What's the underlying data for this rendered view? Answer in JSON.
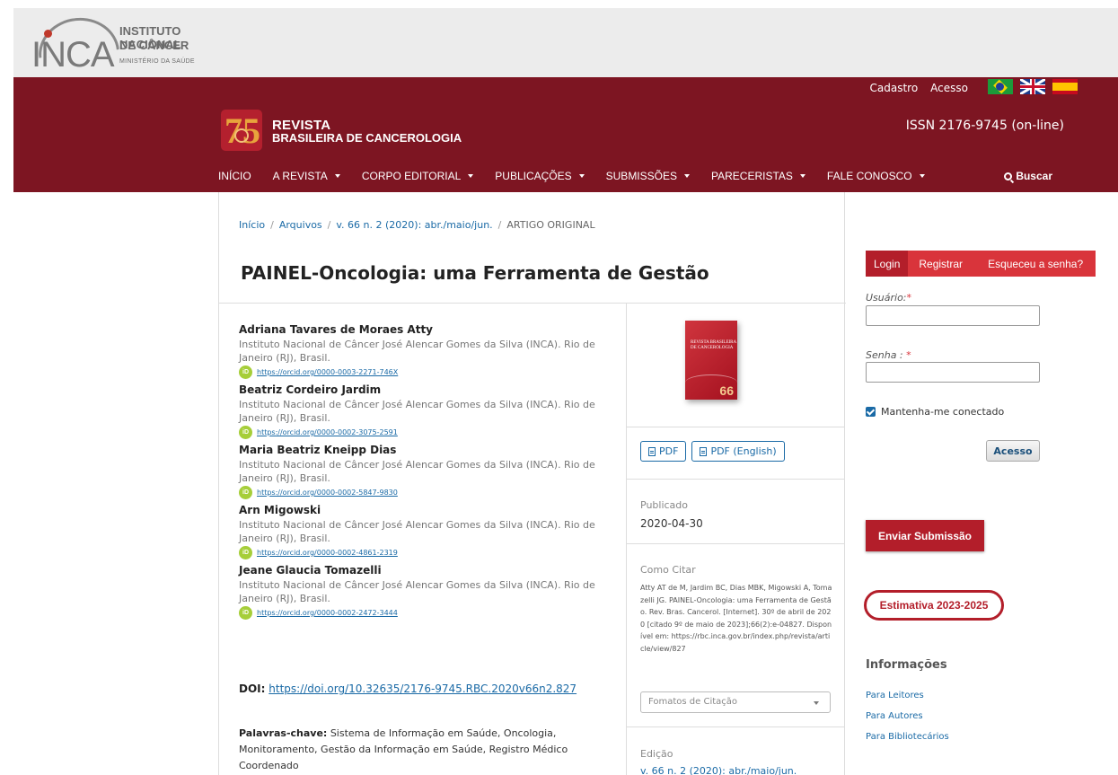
{
  "gov": {
    "logo_word": "INCA",
    "line1": "INSTITUTO NACIONAL",
    "line2": "DE CÂNCER",
    "line3": "MINISTÉRIO DA SAÚDE"
  },
  "header": {
    "cadastro": "Cadastro",
    "acesso": "Acesso",
    "flags": [
      "flag-brazil",
      "flag-uk",
      "flag-spain"
    ],
    "logo_number": "75",
    "journal_title_1": "REVISTA",
    "journal_title_2": "BRASILEIRA DE CANCEROLOGIA",
    "issn": "ISSN 2176-9745 (on-line)"
  },
  "nav": {
    "items": [
      {
        "label": "INÍCIO",
        "dropdown": false
      },
      {
        "label": "A REVISTA",
        "dropdown": true
      },
      {
        "label": "CORPO EDITORIAL",
        "dropdown": true
      },
      {
        "label": "PUBLICAÇÕES",
        "dropdown": true
      },
      {
        "label": "SUBMISSÕES",
        "dropdown": true
      },
      {
        "label": "PARECERISTAS",
        "dropdown": true
      },
      {
        "label": "FALE CONOSCO",
        "dropdown": true
      }
    ],
    "search_label": "Buscar"
  },
  "breadcrumb": {
    "home": "Início",
    "archives": "Arquivos",
    "issue": "v. 66 n. 2 (2020): abr./maio/jun.",
    "current": "ARTIGO ORIGINAL",
    "sep": "/"
  },
  "article": {
    "title": "PAINEL-Oncologia: uma Ferramenta de Gestão",
    "authors": [
      {
        "name": "Adriana Tavares de Moraes Atty",
        "affiliation": "Instituto Nacional de Câncer José Alencar Gomes da Silva (INCA). Rio de Janeiro (RJ), Brasil.",
        "orcid": "https://orcid.org/0000-0003-2271-746X"
      },
      {
        "name": "Beatriz Cordeiro Jardim",
        "affiliation": "Instituto Nacional de Câncer José Alencar Gomes da Silva (INCA). Rio de Janeiro (RJ), Brasil.",
        "orcid": "https://orcid.org/0000-0002-3075-2591"
      },
      {
        "name": "Maria Beatriz Kneipp Dias",
        "affiliation": "Instituto Nacional de Câncer José Alencar Gomes da Silva (INCA). Rio de Janeiro (RJ), Brasil.",
        "orcid": "https://orcid.org/0000-0002-5847-9830"
      },
      {
        "name": "Arn Migowski",
        "affiliation": "Instituto Nacional de Câncer José Alencar Gomes da Silva (INCA). Rio de Janeiro (RJ), Brasil.",
        "orcid": "https://orcid.org/0000-0002-4861-2319"
      },
      {
        "name": "Jeane Glaucia Tomazelli",
        "affiliation": "Instituto Nacional de Câncer José Alencar Gomes da Silva (INCA). Rio de Janeiro (RJ), Brasil.",
        "orcid": "https://orcid.org/0000-0002-2472-3444"
      }
    ],
    "orcid_icon_text": "iD",
    "doi_label": "DOI:",
    "doi_link": "https://doi.org/10.32635/2176-9745.RBC.2020v66n2.827",
    "keywords_label": "Palavras-chave:",
    "keywords": "Sistema de Informação em Saúde, Oncologia, Monitoramento, Gestão da Informação em Saúde, Registro Médico Coordenado"
  },
  "sideinfo": {
    "cover_title": "REVISTA BRASILEIRA DE CANCEROLOGIA",
    "cover_number": "66",
    "pdf_label": "PDF",
    "pdf_en_label": "PDF (English)",
    "published_label": "Publicado",
    "published_date": "2020-04-30",
    "cite_label": "Como Citar",
    "cite_text": "Atty AT de M, Jardim BC, Dias MBK, Migowski A, Tomazelli JG. PAINEL-Oncologia: uma Ferramenta de Gestão. Rev. Bras. Cancerol. [Internet]. 30º de abril de 2020 [citado 9º de maio de 2023];66(2):e-04827. Disponível em: https://rbc.inca.gov.br/index.php/revista/article/view/827",
    "cite_formats": "Fomatos de Citação",
    "edition_label": "Edição",
    "edition_link": "v. 66 n. 2 (2020): abr./maio/jun."
  },
  "sidebar": {
    "tab_login": "Login",
    "tab_register": "Registrar",
    "tab_forgot": "Esqueceu a senha?",
    "user_label": "Usuário:",
    "pass_label": "Senha : ",
    "required": "*",
    "remember_label": "Mantenha-me conectado",
    "login_button": "Acesso",
    "submit_button": "Enviar Submissão",
    "estimativa_button": "Estimativa 2023-2025",
    "info_title": "Informações",
    "info_links": [
      "Para Leitores",
      "Para Autores",
      "Para Bibliotecários"
    ]
  },
  "colors": {
    "header_bg": "#7d1522",
    "accent_red": "#b31e2a",
    "link_blue": "#1a6aa6"
  }
}
